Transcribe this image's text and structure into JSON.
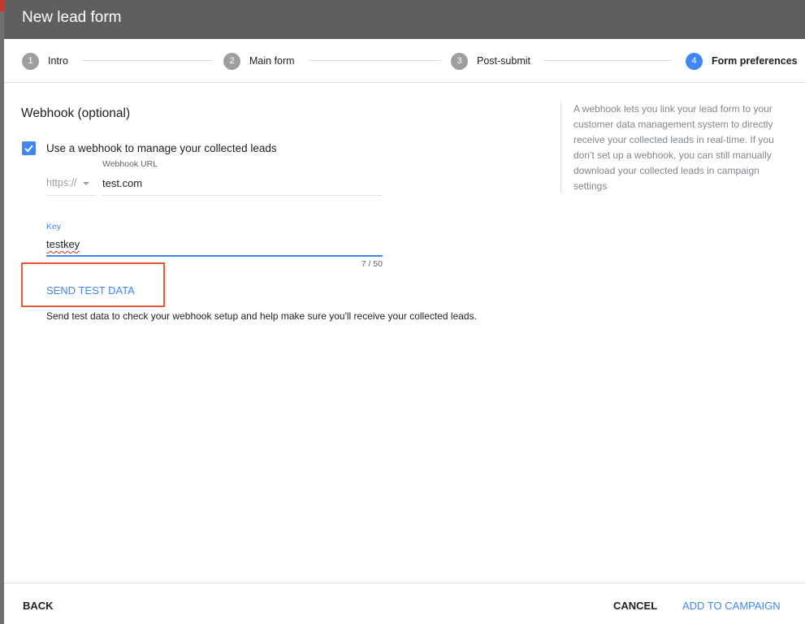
{
  "header": {
    "title": "New lead form"
  },
  "stepper": {
    "steps": [
      {
        "number": "1",
        "label": "Intro",
        "state": "inactive"
      },
      {
        "number": "2",
        "label": "Main form",
        "state": "inactive"
      },
      {
        "number": "3",
        "label": "Post-submit",
        "state": "inactive"
      },
      {
        "number": "4",
        "label": "Form preferences",
        "state": "active"
      }
    ]
  },
  "webhook": {
    "title": "Webhook (optional)",
    "checkbox_label": "Use a webhook to manage your collected leads",
    "checkbox_checked": true,
    "protocol": "https://",
    "url_label": "Webhook URL",
    "url_value": "test.com",
    "key_label": "Key",
    "key_value": "testkey",
    "key_counter": "7 / 50",
    "send_test_label": "SEND TEST DATA",
    "send_test_description": "Send test data to check your webhook setup and help make sure you'll receive your collected leads.",
    "help_text": "A webhook lets you link your lead form to your customer data management system to directly receive your collected leads in real-time. If you don't set up a webhook, you can still manually download your collected leads in campaign settings"
  },
  "footer": {
    "back_label": "BACK",
    "cancel_label": "CANCEL",
    "add_label": "ADD TO CAMPAIGN"
  },
  "colors": {
    "accent": "#4285f4",
    "header_bg": "#5f5f5f",
    "highlight": "#e8593c"
  }
}
